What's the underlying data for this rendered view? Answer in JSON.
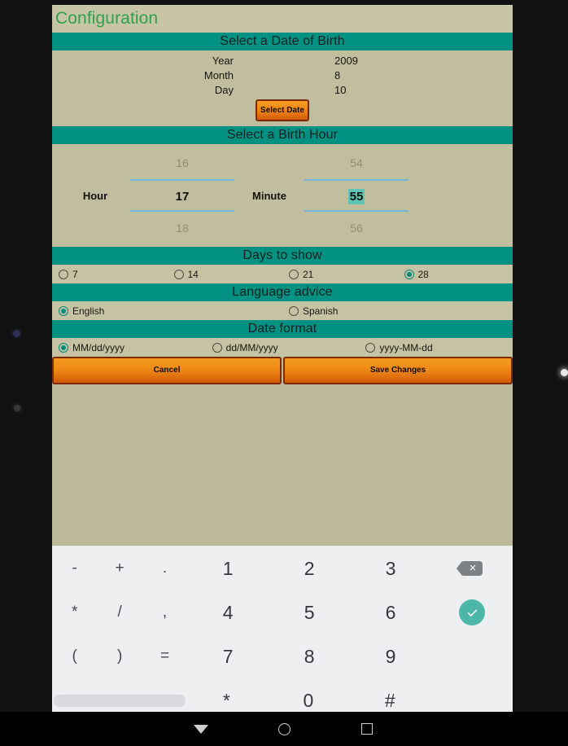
{
  "page_title": "Configuration",
  "colors": {
    "accent_teal": "#009182",
    "title_green": "#2fa14a",
    "app_background": "#bdba9c",
    "button_orange": "#f08a16",
    "button_border": "#7d2b06",
    "picker_divider": "#6fb7dc",
    "selection_highlight": "#5fc4b4",
    "keyboard_background": "#edeff1",
    "enter_key": "#4cb6a9"
  },
  "date_section": {
    "header": "Select a Date of Birth",
    "rows": [
      {
        "label": "Year",
        "value": "2009"
      },
      {
        "label": "Month",
        "value": "8"
      },
      {
        "label": "Day",
        "value": "10"
      }
    ],
    "select_date_button": "Select Date"
  },
  "hour_section": {
    "header": "Select a Birth Hour",
    "hour": {
      "label": "Hour",
      "previous": "16",
      "selected": "17",
      "next": "18"
    },
    "minute": {
      "label": "Minute",
      "previous": "54",
      "selected": "55",
      "next": "56"
    }
  },
  "days_section": {
    "header": "Days to show",
    "options": [
      {
        "label": "7",
        "selected": false
      },
      {
        "label": "14",
        "selected": false
      },
      {
        "label": "21",
        "selected": false
      },
      {
        "label": "28",
        "selected": true
      }
    ]
  },
  "language_section": {
    "header": "Language advice",
    "options": [
      {
        "label": "English",
        "selected": true
      },
      {
        "label": "Spanish",
        "selected": false
      }
    ]
  },
  "date_format_section": {
    "header": "Date format",
    "options": [
      {
        "label": "MM/dd/yyyy",
        "selected": true
      },
      {
        "label": "dd/MM/yyyy",
        "selected": false
      },
      {
        "label": "yyyy-MM-dd",
        "selected": false
      }
    ]
  },
  "actions": {
    "cancel": "Cancel",
    "save": "Save Changes"
  },
  "keyboard": {
    "rows": [
      {
        "symbols": [
          "-",
          "+",
          "."
        ],
        "numbers": [
          "1",
          "2",
          "3"
        ],
        "action": "backspace-icon"
      },
      {
        "symbols": [
          "*",
          "/",
          ","
        ],
        "numbers": [
          "4",
          "5",
          "6"
        ],
        "action": "enter-icon"
      },
      {
        "symbols": [
          "(",
          ")",
          "="
        ],
        "numbers": [
          "7",
          "8",
          "9"
        ],
        "action": ""
      },
      {
        "symbols": [
          "spacebar"
        ],
        "numbers": [
          "*",
          "0",
          "#"
        ],
        "action": ""
      }
    ],
    "backspace_glyph": "✕"
  },
  "navbar": {
    "back": "back-icon",
    "home": "home-icon",
    "recents": "recents-icon"
  }
}
